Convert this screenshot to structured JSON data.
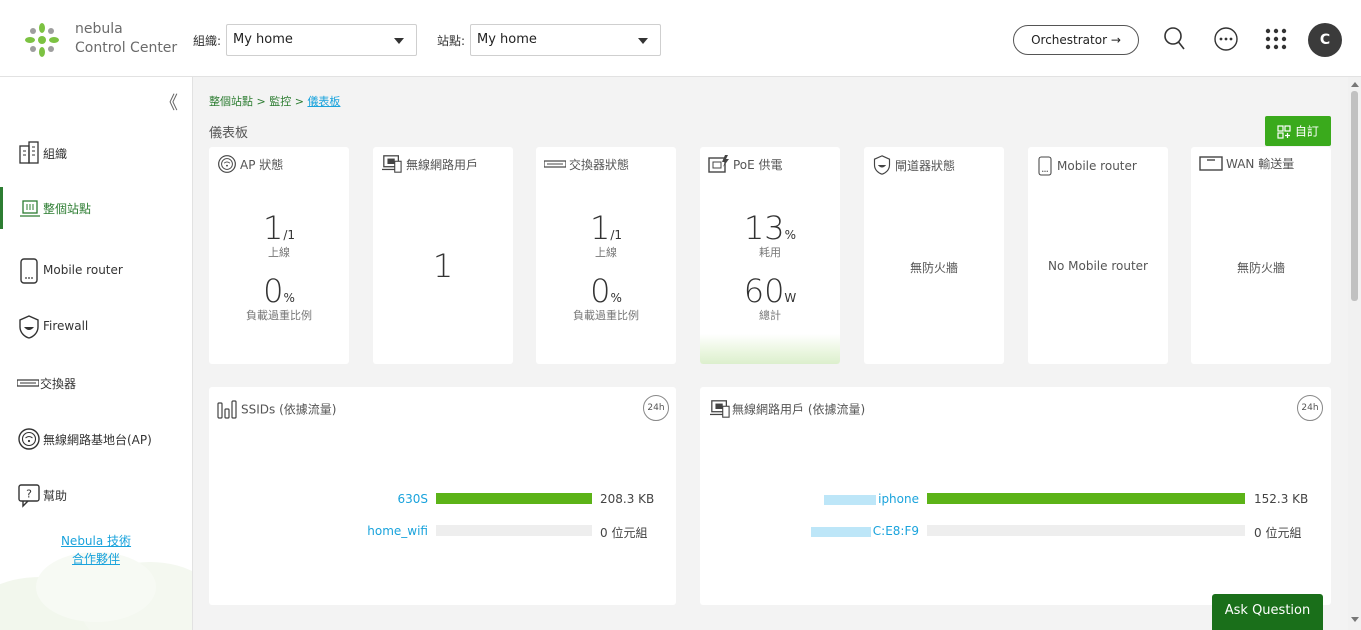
{
  "header": {
    "brand_line1": "nebula",
    "brand_line2": "Control Center",
    "org_label": "組織:",
    "org_value": "My home",
    "site_label": "站點:",
    "site_value": "My home",
    "orchestrator_label": "Orchestrator →",
    "avatar_letter": "C",
    "icons": [
      "search-icon",
      "more-icon",
      "apps-grid-icon"
    ]
  },
  "sidebar": {
    "collapse_glyph": "《",
    "items": [
      {
        "label": "組織",
        "icon": "building-icon",
        "active": false
      },
      {
        "label": "整個站點",
        "icon": "site-icon",
        "active": true
      },
      {
        "label": "Mobile router",
        "icon": "mobile-router-icon",
        "active": false
      },
      {
        "label": "Firewall",
        "icon": "firewall-icon",
        "active": false
      },
      {
        "label": "交換器",
        "icon": "switch-icon",
        "active": false
      },
      {
        "label": "無線網路基地台(AP)",
        "icon": "ap-icon",
        "active": false
      },
      {
        "label": "幫助",
        "icon": "help-icon",
        "active": false
      }
    ],
    "partner_line1": "Nebula 技術",
    "partner_line2": "合作夥伴"
  },
  "breadcrumb": {
    "part1": "整個站點",
    "sep": " > ",
    "part2": "監控",
    "current": "儀表板"
  },
  "page": {
    "title": "儀表板",
    "customize_label": "自訂"
  },
  "cards": {
    "ap": {
      "title": "AP 狀態",
      "online_num": "1",
      "online_den": "/1",
      "online_label": "上線",
      "load_num": "0",
      "load_unit": "%",
      "load_label": "負載過重比例"
    },
    "wifi_clients": {
      "title": "無線網路用戶",
      "value": "1"
    },
    "switch": {
      "title": "交換器狀態",
      "online_num": "1",
      "online_den": "/1",
      "online_label": "上線",
      "load_num": "0",
      "load_unit": "%",
      "load_label": "負載過重比例"
    },
    "poe": {
      "title": "PoE 供電",
      "used_num": "13",
      "used_unit": "%",
      "used_label": "耗用",
      "total_num": "60",
      "total_unit": "W",
      "total_label": "總計"
    },
    "gateway": {
      "title": "閘道器狀態",
      "message": "無防火牆"
    },
    "mobile_router": {
      "title": "Mobile router",
      "message": "No Mobile router"
    },
    "wan": {
      "title": "WAN 輸送量",
      "message": "無防火牆"
    }
  },
  "ssids_panel": {
    "title": "SSIDs (依據流量)",
    "period": "24h",
    "rows": [
      {
        "name": "630S",
        "fraction": 1.0,
        "value": "208.3 KB"
      },
      {
        "name": "home_wifi",
        "fraction": 0.0,
        "value": "0 位元組"
      }
    ]
  },
  "clients_panel": {
    "title": "無線網路用戶 (依據流量)",
    "period": "24h",
    "rows": [
      {
        "name": "iphone",
        "fraction": 1.0,
        "value": "152.3 KB"
      },
      {
        "name": "C:E8:F9",
        "fraction": 0.0,
        "value": "0 位元組"
      }
    ]
  },
  "ask_label": "Ask Question",
  "colors": {
    "accent": "#3aaa1c",
    "bar": "#5cb318",
    "link": "#1aa3dc",
    "active": "#2d7d32"
  }
}
